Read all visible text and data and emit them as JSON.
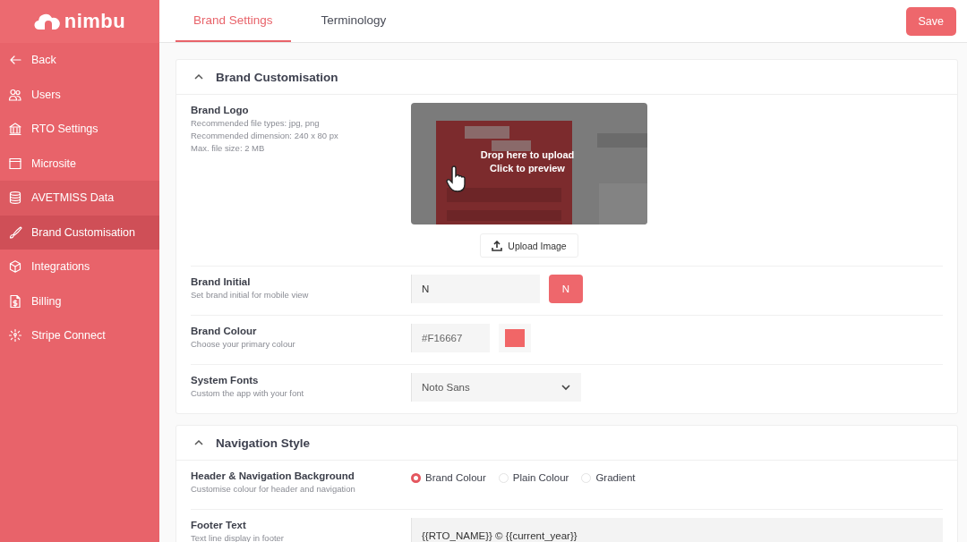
{
  "brand": {
    "name": "nimbu"
  },
  "sidebar": {
    "items": [
      {
        "label": "Back",
        "selected": false,
        "highlighted": false
      },
      {
        "label": "Users",
        "selected": false,
        "highlighted": false
      },
      {
        "label": "RTO Settings",
        "selected": false,
        "highlighted": false
      },
      {
        "label": "Microsite",
        "selected": false,
        "highlighted": false
      },
      {
        "label": "AVETMISS Data",
        "selected": false,
        "highlighted": true
      },
      {
        "label": "Brand Customisation",
        "selected": true,
        "highlighted": false
      },
      {
        "label": "Integrations",
        "selected": false,
        "highlighted": false
      },
      {
        "label": "Billing",
        "selected": false,
        "highlighted": false
      },
      {
        "label": "Stripe Connect",
        "selected": false,
        "highlighted": false
      }
    ]
  },
  "tabs": [
    {
      "label": "Brand Settings",
      "selected": true
    },
    {
      "label": "Terminology",
      "selected": false
    }
  ],
  "save_button": "Save",
  "sections": [
    {
      "title": "Brand Customisation",
      "expanded": true,
      "rows": [
        {
          "kind": "logo",
          "label": "Brand Logo",
          "hints": [
            "Recommended file types: jpg, png",
            "Recommended dimension: 240 x 80 px",
            "Max. file size: 2 MB"
          ],
          "drop_text": [
            "Drop here to upload",
            "Click to preview"
          ],
          "button": "Upload Image"
        },
        {
          "kind": "initial",
          "label": "Brand Initial",
          "hints": [
            "Set brand initial for mobile view"
          ],
          "value": "N",
          "preview": "N"
        },
        {
          "kind": "colour",
          "label": "Brand Colour",
          "hints": [
            "Choose your primary colour"
          ],
          "value": "#F16667"
        },
        {
          "kind": "select",
          "label": "System Fonts",
          "hints": [
            "Custom the app with your font"
          ],
          "value": "Noto Sans"
        }
      ]
    },
    {
      "title": "Navigation Style",
      "expanded": true,
      "rows": [
        {
          "kind": "radio",
          "label": "Header & Navigation Background",
          "hints": [
            "Customise colour for header and navigation"
          ],
          "options": [
            {
              "label": "Brand Colour",
              "selected": true
            },
            {
              "label": "Plain Colour",
              "selected": false
            },
            {
              "label": "Gradient",
              "selected": false
            }
          ]
        },
        {
          "kind": "text",
          "label": "Footer Text",
          "hints": [
            "Text line display in footer"
          ],
          "value": "{{RTO_NAME}} © {{current_year}}"
        }
      ]
    }
  ]
}
